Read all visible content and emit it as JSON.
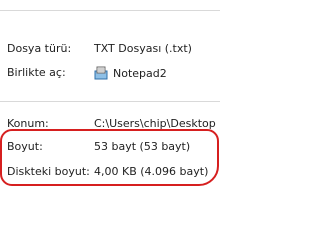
{
  "properties": {
    "file_type": {
      "label": "Dosya türü:",
      "value": "TXT Dosyası (.txt)"
    },
    "opens_with": {
      "label": "Birlikte aç:",
      "value": "Notepad2",
      "icon": "notepad2-icon"
    },
    "location": {
      "label": "Konum:",
      "value": "C:\\Users\\chip\\Desktop"
    },
    "size": {
      "label": "Boyut:",
      "value": "53 bayt (53 bayt)"
    },
    "size_on_disk": {
      "label": "Diskteki boyut:",
      "value": "4,00 KB (4.096 bayt)"
    }
  },
  "colors": {
    "highlight": "#d61f1f",
    "separator": "#d9d9d9"
  }
}
